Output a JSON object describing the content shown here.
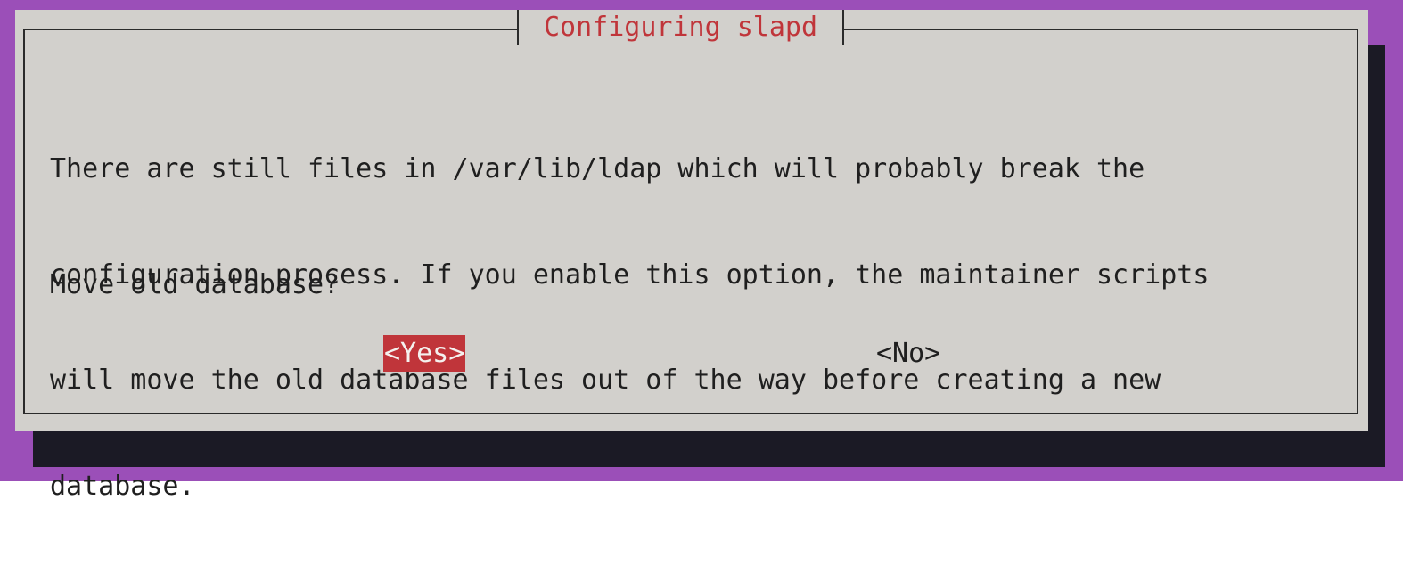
{
  "colors": {
    "terminal_bg": "#9b4fb8",
    "dialog_bg": "#d2d0cc",
    "shadow": "#1b1a25",
    "accent": "#c0353a",
    "text": "#1f1f1f"
  },
  "dialog": {
    "title": "Configuring slapd",
    "message_lines": [
      "There are still files in /var/lib/ldap which will probably break the",
      "configuration process. If you enable this option, the maintainer scripts",
      "will move the old database files out of the way before creating a new",
      "database."
    ],
    "question": "Move old database?",
    "buttons": {
      "yes_label": "<Yes>",
      "no_label": "<No>",
      "selected": "yes"
    }
  }
}
